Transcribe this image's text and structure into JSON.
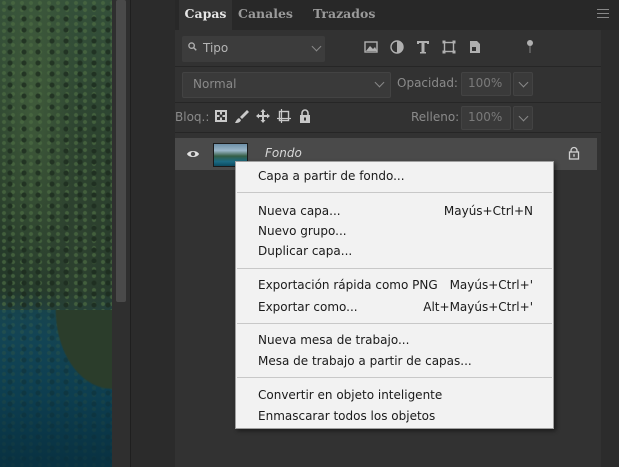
{
  "panel": {
    "tabs": [
      {
        "label": "Capas",
        "active": true
      },
      {
        "label": "Canales",
        "active": false
      },
      {
        "label": "Trazados",
        "active": false
      }
    ],
    "menu_icon": "hamburger-menu-icon"
  },
  "filter": {
    "kind_label": "Tipo",
    "icons": [
      "image-filter-icon",
      "adjustment-filter-icon",
      "type-filter-icon",
      "shape-filter-icon",
      "smart-object-filter-icon",
      "filter-toggle-icon"
    ]
  },
  "blend": {
    "mode": "Normal",
    "opacity_label": "Opacidad:",
    "opacity_value": "100%"
  },
  "locks": {
    "label": "Bloq.:",
    "icons": [
      "lock-transparent-pixels-icon",
      "lock-image-pixels-icon",
      "lock-position-icon",
      "lock-artboard-icon",
      "lock-all-icon"
    ],
    "fill_label": "Relleno:",
    "fill_value": "100%"
  },
  "layers": [
    {
      "name": "Fondo",
      "visible": true,
      "locked": true
    }
  ],
  "context_menu": {
    "groups": [
      [
        {
          "label": "Capa a partir de fondo...",
          "shortcut": ""
        }
      ],
      [
        {
          "label": "Nueva capa...",
          "shortcut": "Mayús+Ctrl+N"
        },
        {
          "label": "Nuevo grupo...",
          "shortcut": ""
        },
        {
          "label": "Duplicar capa...",
          "shortcut": ""
        }
      ],
      [
        {
          "label": "Exportación rápida como PNG",
          "shortcut": "Mayús+Ctrl+'"
        },
        {
          "label": "Exportar como...",
          "shortcut": "Alt+Mayús+Ctrl+'"
        }
      ],
      [
        {
          "label": "Nueva mesa de trabajo...",
          "shortcut": ""
        },
        {
          "label": "Mesa de trabajo a partir de capas...",
          "shortcut": ""
        }
      ],
      [
        {
          "label": "Convertir en objeto inteligente",
          "shortcut": ""
        },
        {
          "label": "Enmascarar todos los objetos",
          "shortcut": ""
        }
      ]
    ]
  }
}
